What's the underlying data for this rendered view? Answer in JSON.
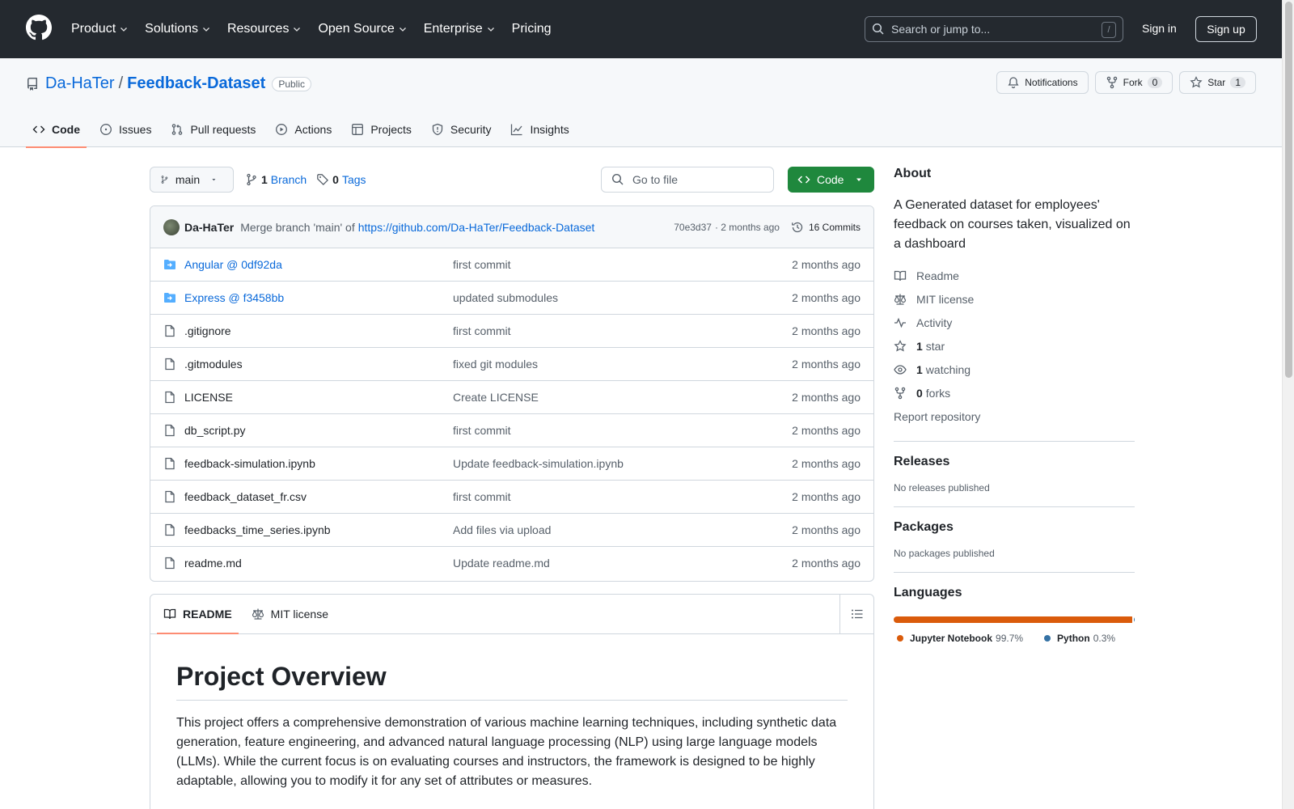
{
  "header": {
    "nav": [
      {
        "label": "Product",
        "dropdown": true
      },
      {
        "label": "Solutions",
        "dropdown": true
      },
      {
        "label": "Resources",
        "dropdown": true
      },
      {
        "label": "Open Source",
        "dropdown": true
      },
      {
        "label": "Enterprise",
        "dropdown": true
      },
      {
        "label": "Pricing",
        "dropdown": false
      }
    ],
    "search_placeholder": "Search or jump to...",
    "search_shortcut": "/",
    "signin": "Sign in",
    "signup": "Sign up"
  },
  "repo": {
    "owner": "Da-HaTer",
    "separator": "/",
    "name": "Feedback-Dataset",
    "visibility": "Public",
    "notifications_label": "Notifications",
    "fork_label": "Fork",
    "fork_count": "0",
    "star_label": "Star",
    "star_count": "1"
  },
  "tabs": [
    {
      "label": "Code",
      "icon": "code-icon",
      "active": true
    },
    {
      "label": "Issues",
      "icon": "issue-icon",
      "active": false
    },
    {
      "label": "Pull requests",
      "icon": "pull-request-icon",
      "active": false
    },
    {
      "label": "Actions",
      "icon": "play-icon",
      "active": false
    },
    {
      "label": "Projects",
      "icon": "table-icon",
      "active": false
    },
    {
      "label": "Security",
      "icon": "shield-icon",
      "active": false
    },
    {
      "label": "Insights",
      "icon": "graph-icon",
      "active": false
    }
  ],
  "branchbar": {
    "branch": "main",
    "branch_count": "1",
    "branch_label": "Branch",
    "tag_count": "0",
    "tag_label": "Tags",
    "goto_placeholder": "Go to file",
    "code_button": "Code"
  },
  "commit": {
    "author": "Da-HaTer",
    "message": "Merge branch 'main' of",
    "link": "https://github.com/Da-HaTer/Feedback-Dataset",
    "hash": "70e3d37",
    "age": "· 2 months ago",
    "commits_label": "16 Commits"
  },
  "files": [
    {
      "name": "Angular @ 0df92da",
      "type": "submodule",
      "message": "first commit",
      "age": "2 months ago"
    },
    {
      "name": "Express @ f3458bb",
      "type": "submodule",
      "message": "updated submodules",
      "age": "2 months ago"
    },
    {
      "name": ".gitignore",
      "type": "file",
      "message": "first commit",
      "age": "2 months ago"
    },
    {
      "name": ".gitmodules",
      "type": "file",
      "message": "fixed git modules",
      "age": "2 months ago"
    },
    {
      "name": "LICENSE",
      "type": "file",
      "message": "Create LICENSE",
      "age": "2 months ago"
    },
    {
      "name": "db_script.py",
      "type": "file",
      "message": "first commit",
      "age": "2 months ago"
    },
    {
      "name": "feedback-simulation.ipynb",
      "type": "file",
      "message": "Update feedback-simulation.ipynb",
      "age": "2 months ago"
    },
    {
      "name": "feedback_dataset_fr.csv",
      "type": "file",
      "message": "first commit",
      "age": "2 months ago"
    },
    {
      "name": "feedbacks_time_series.ipynb",
      "type": "file",
      "message": "Add files via upload",
      "age": "2 months ago"
    },
    {
      "name": "readme.md",
      "type": "file",
      "message": "Update readme.md",
      "age": "2 months ago"
    }
  ],
  "readme": {
    "tab_readme": "README",
    "tab_license": "MIT license",
    "heading": "Project Overview",
    "paragraph": "This project offers a comprehensive demonstration of various machine learning techniques, including synthetic data generation, feature engineering, and advanced natural language processing (NLP) using large language models (LLMs). While the current focus is on evaluating courses and instructors, the framework is designed to be highly adaptable, allowing you to modify it for any set of attributes or measures."
  },
  "sidebar": {
    "about_title": "About",
    "about_desc": "A Generated dataset for employees' feedback on courses taken, visualized on a dashboard",
    "links": {
      "readme": "Readme",
      "license": "MIT license",
      "activity": "Activity",
      "stars_count": "1",
      "stars_label": "star",
      "watching_count": "1",
      "watching_label": "watching",
      "forks_count": "0",
      "forks_label": "forks"
    },
    "report": "Report repository",
    "releases_title": "Releases",
    "releases_desc": "No releases published",
    "packages_title": "Packages",
    "packages_desc": "No packages published",
    "languages_title": "Languages",
    "languages": [
      {
        "name": "Jupyter Notebook",
        "percent": "99.7%",
        "value": 99.7,
        "color": "#DA5B0B"
      },
      {
        "name": "Python",
        "percent": "0.3%",
        "value": 0.3,
        "color": "#3572A5"
      }
    ]
  },
  "colors": {
    "header_bg": "#24292f",
    "link": "#0969da",
    "primary_button": "#1f883d",
    "tab_underline": "#fd8c73"
  }
}
